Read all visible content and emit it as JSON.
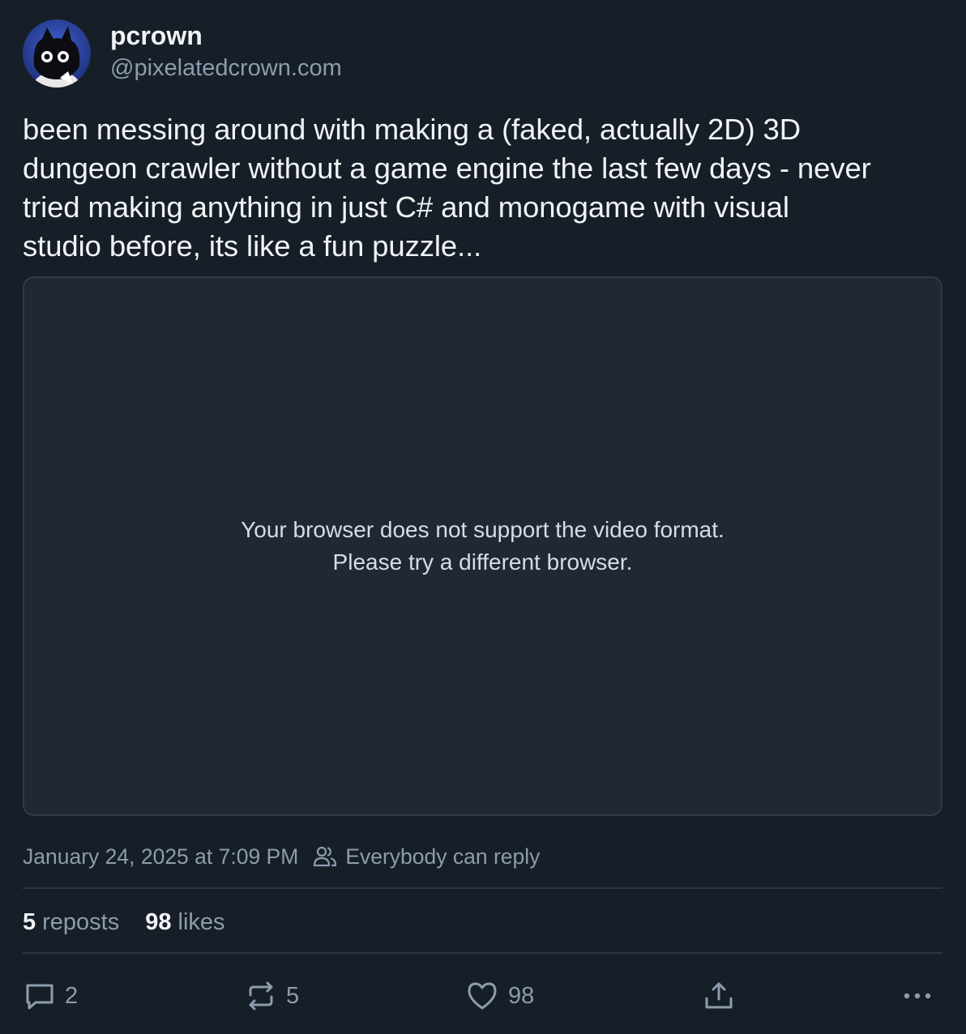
{
  "author": {
    "display_name": "pcrown",
    "handle": "@pixelatedcrown.com",
    "avatar_icon": "cat-avatar-icon"
  },
  "post": {
    "text": "been messing around with making a (faked, actually 2D) 3D\ndungeon crawler without a game engine the last few days - never\ntried making anything in just C# and monogame with visual\nstudio before, its like a fun puzzle..."
  },
  "video": {
    "message": "Your browser does not support the video format. Please try a different browser."
  },
  "meta": {
    "timestamp": "January 24, 2025 at 7:09 PM",
    "reply_setting": "Everybody can reply"
  },
  "stats": {
    "reposts_count": "5",
    "reposts_label": "reposts",
    "likes_count": "98",
    "likes_label": "likes"
  },
  "actions": {
    "reply_count": "2",
    "repost_count": "5",
    "like_count": "98"
  },
  "colors": {
    "background": "#161e27",
    "text_primary": "#f1f3f5",
    "text_muted": "#8d9cad",
    "video_bg": "#1f2833",
    "border": "#2e3b49"
  }
}
